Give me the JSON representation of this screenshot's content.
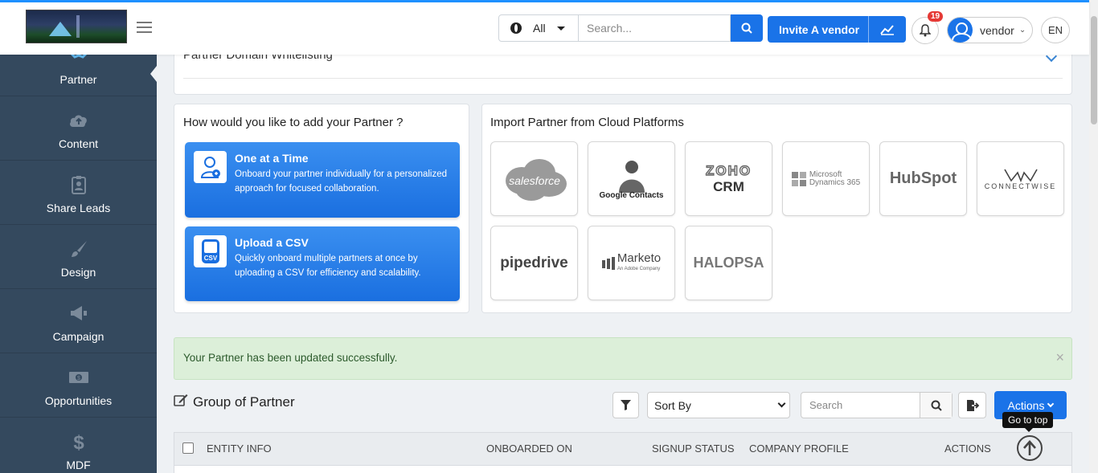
{
  "header": {
    "scope": "All",
    "search_placeholder": "Search...",
    "invite_label": "Invite A vendor",
    "notification_count": "19",
    "user_name": "vendor",
    "language": "EN"
  },
  "sidebar": {
    "items": [
      {
        "label": "Partner",
        "icon": "handshake-icon"
      },
      {
        "label": "Content",
        "icon": "cloud-upload-icon"
      },
      {
        "label": "Share Leads",
        "icon": "clipboard-user-icon"
      },
      {
        "label": "Design",
        "icon": "paintbrush-icon"
      },
      {
        "label": "Campaign",
        "icon": "megaphone-icon"
      },
      {
        "label": "Opportunities",
        "icon": "money-bill-icon"
      },
      {
        "label": "MDF",
        "icon": "dollar-icon"
      }
    ]
  },
  "whitelist": {
    "title": "Partner Domain Whitelisting"
  },
  "add_partner": {
    "question": "How would you like to add your Partner ?",
    "options": [
      {
        "title": "One at a Time",
        "description": "Onboard your partner individually for a personalized approach for focused collaboration."
      },
      {
        "title": "Upload a CSV",
        "description": "Quickly onboard multiple partners at once by uploading a CSV for efficiency and scalability.",
        "badge": "CSV"
      }
    ]
  },
  "import": {
    "title": "Import Partner from Cloud Platforms",
    "platforms": [
      {
        "name": "salesforce"
      },
      {
        "name": "Google Contacts"
      },
      {
        "name": "ZOHO",
        "sub": "CRM"
      },
      {
        "name": "Microsoft",
        "sub": "Dynamics 365"
      },
      {
        "name": "HubSpot"
      },
      {
        "name": "CONNECTWISE"
      },
      {
        "name": "pipedrive"
      },
      {
        "name": "Marketo",
        "sub": "An Adobe Company"
      },
      {
        "name": "HALOPSA"
      }
    ]
  },
  "alert": {
    "message": "Your Partner has been updated successfully.",
    "close": "×"
  },
  "group": {
    "title": "Group of Partner",
    "sort_label": "Sort By",
    "search_placeholder": "Search",
    "actions_label": "Actions"
  },
  "table": {
    "columns": [
      "ENTITY INFO",
      "ONBOARDED ON",
      "SIGNUP STATUS",
      "COMPANY PROFILE",
      "ACTIONS"
    ]
  },
  "tooltip": "Go to top",
  "colors": {
    "primary": "#1a73e8",
    "sidebar": "#34495e",
    "alert_bg": "#dcefd9"
  }
}
